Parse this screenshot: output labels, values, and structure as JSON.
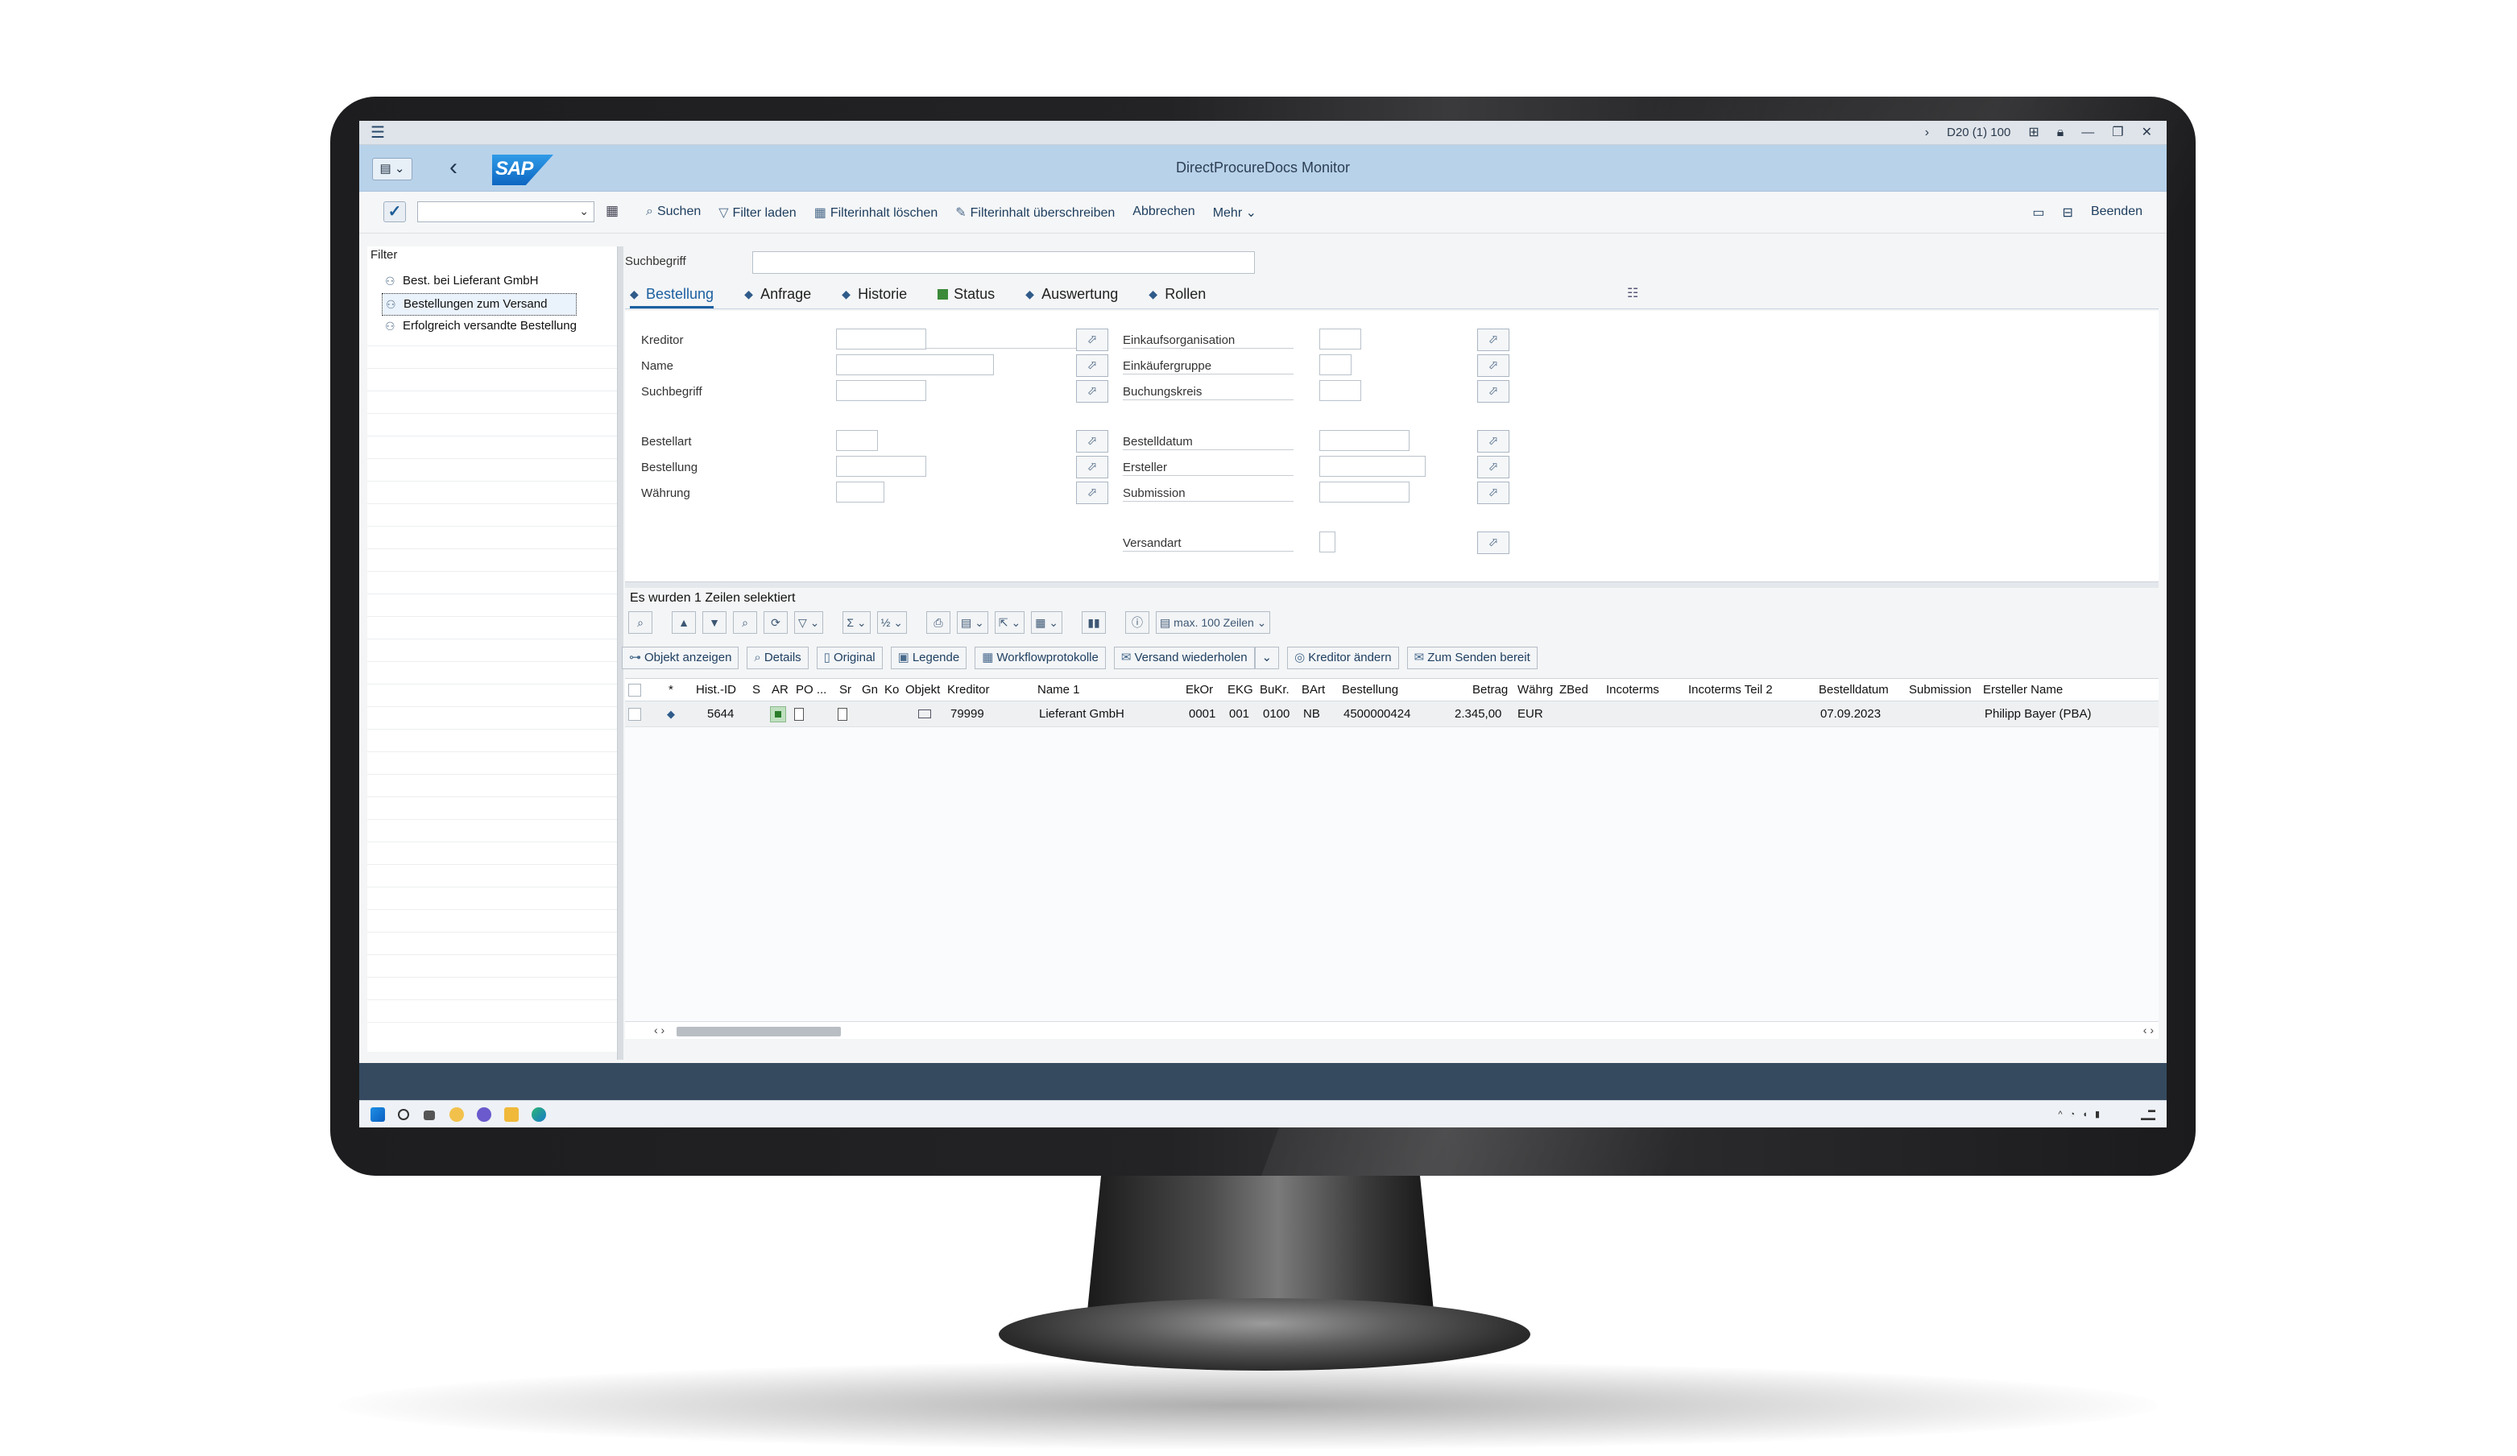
{
  "window": {
    "system": "D20 (1) 100",
    "title": "DirectProcureDocs Monitor"
  },
  "toolbar": {
    "buttons": [
      "Suchen",
      "Filter laden",
      "Filterinhalt löschen",
      "Filterinhalt überschreiben",
      "Abbrechen",
      "Mehr"
    ],
    "end_label": "Beenden"
  },
  "filter_panel": {
    "label": "Filter",
    "items": [
      "Best. bei Lieferant GmbH",
      "Bestellungen zum Versand",
      "Erfolgreich versandte Bestellung"
    ],
    "selected_index": 1
  },
  "search": {
    "label": "Suchbegriff",
    "value": ""
  },
  "tabs": [
    "Bestellung",
    "Anfrage",
    "Historie",
    "Status",
    "Auswertung",
    "Rollen"
  ],
  "active_tab": "Bestellung",
  "form": {
    "left_fields": [
      "Kreditor",
      "Name",
      "Suchbegriff",
      "Bestellart",
      "Bestellung",
      "Währung"
    ],
    "right_fields": [
      "Einkaufsorganisation",
      "Einkäufergruppe",
      "Buchungskreis",
      "Bestelldatum",
      "Ersteller",
      "Submission",
      "Versandart"
    ]
  },
  "result": {
    "selection_info": "Es wurden 1 Zeilen selektiert",
    "max_rows_label": "max. 100 Zeilen",
    "actions": [
      "Objekt anzeigen",
      "Details",
      "Original",
      "Legende",
      "Workflowprotokolle",
      "Versand wiederholen",
      "Kreditor ändern",
      "Zum Senden bereit"
    ]
  },
  "table": {
    "columns": [
      "*",
      "Hist.-ID",
      "S",
      "AR",
      "PO ...",
      "Sr",
      "Gn",
      "Ko",
      "Objekt",
      "Kreditor",
      "Name 1",
      "EkOr",
      "EKG",
      "BuKr.",
      "BArt",
      "Bestellung",
      "Betrag",
      "Währg",
      "ZBed",
      "Incoterms",
      "Incoterms Teil 2",
      "Bestelldatum",
      "Submission",
      "Ersteller Name"
    ],
    "rows": [
      {
        "star": "◆",
        "hist_id": "5644",
        "kreditor": "79999",
        "name1": "Lieferant GmbH",
        "ekor": "0001",
        "ekg": "001",
        "bukr": "0100",
        "bart": "NB",
        "bestellung": "4500000424",
        "betrag": "2.345,00",
        "waehrg": "EUR",
        "bestelldatum": "07.09.2023",
        "ersteller": "Philipp Bayer (PBA)"
      }
    ]
  },
  "colors": {
    "title_bar": "#b8d2ea",
    "accent": "#1b5fa0",
    "status_green": "#2b7c2b",
    "dark_bar": "#354a5f"
  }
}
